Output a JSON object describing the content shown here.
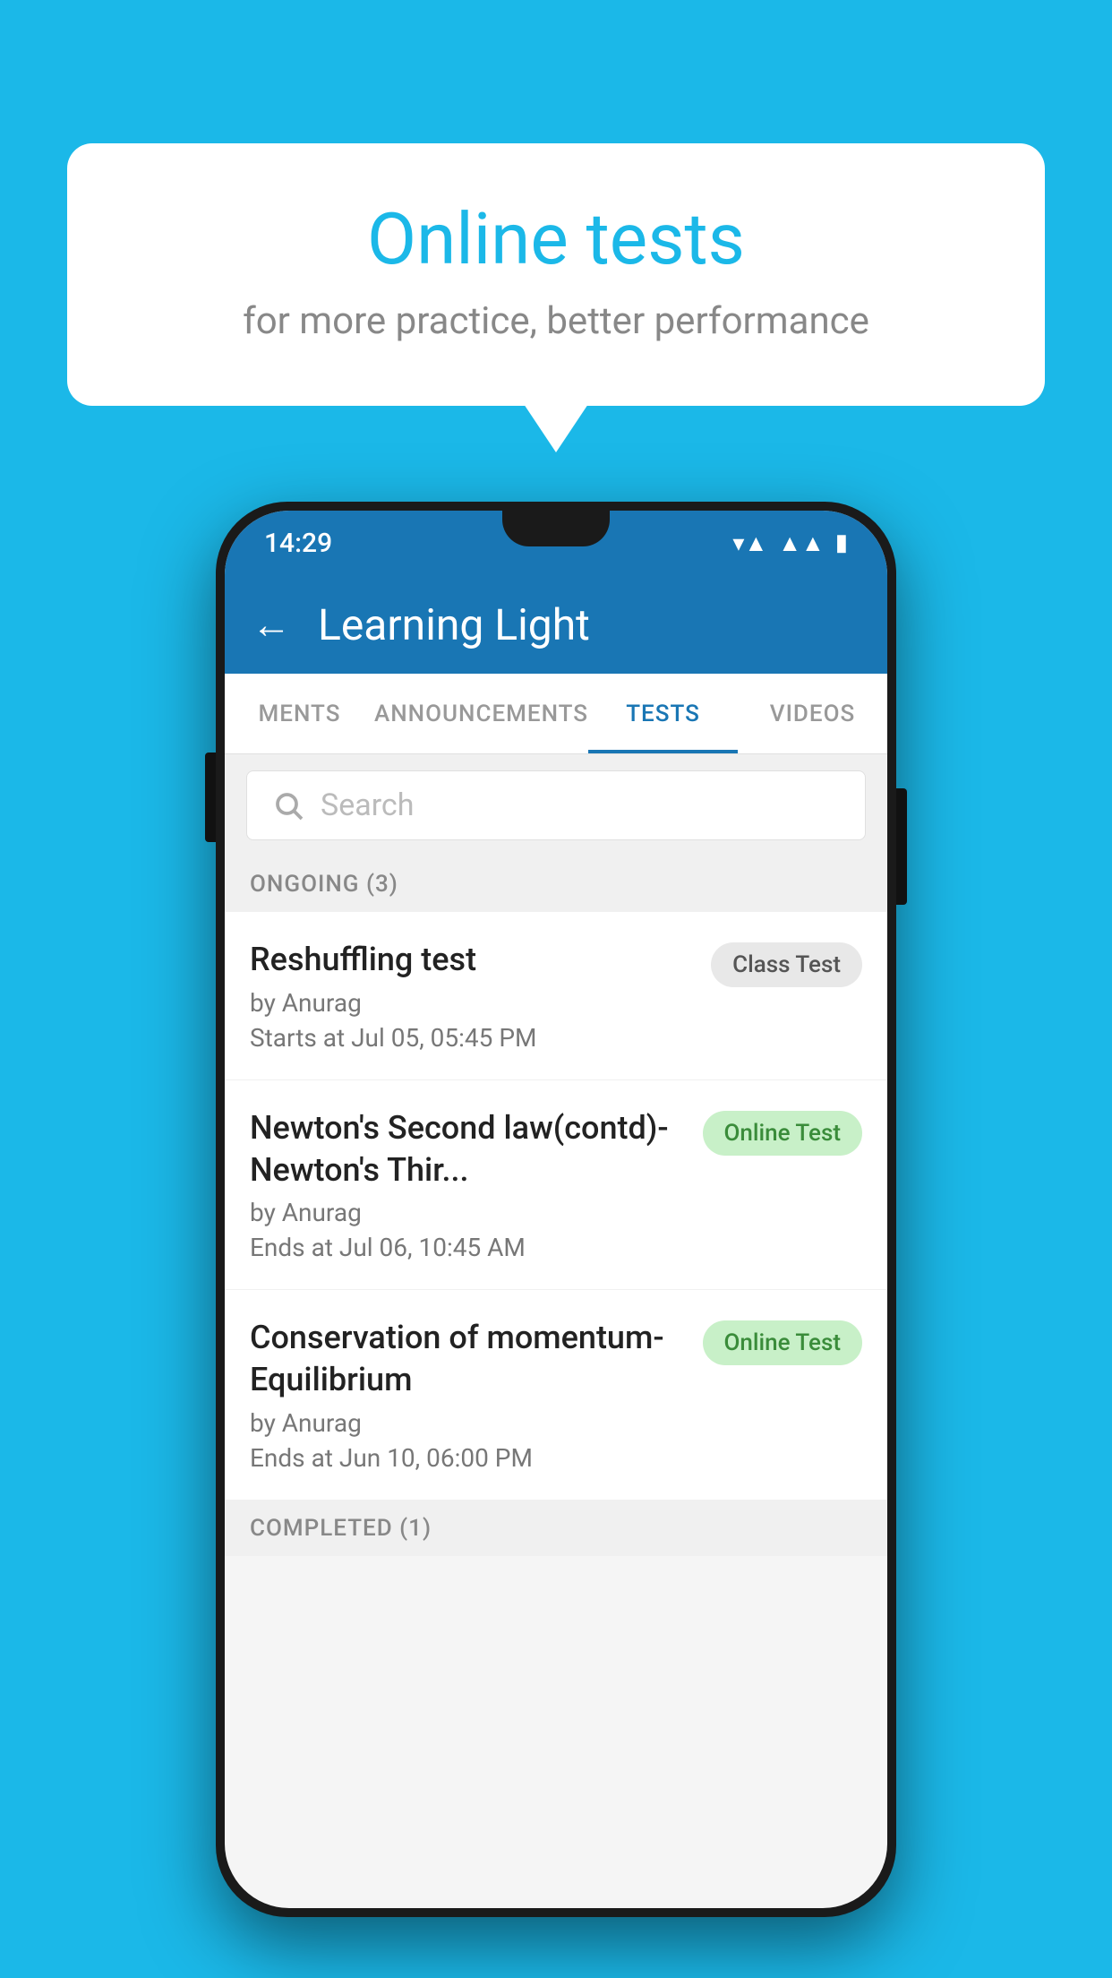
{
  "background": {
    "color": "#1bb8e8"
  },
  "speech_bubble": {
    "title": "Online tests",
    "subtitle": "for more practice, better performance"
  },
  "phone": {
    "status_bar": {
      "time": "14:29",
      "wifi": "▼▲",
      "signal": "▲▲",
      "battery": "▮"
    },
    "app_bar": {
      "back_label": "←",
      "title": "Learning Light"
    },
    "tabs": [
      {
        "label": "MENTS",
        "active": false
      },
      {
        "label": "ANNOUNCEMENTS",
        "active": false
      },
      {
        "label": "TESTS",
        "active": true
      },
      {
        "label": "VIDEOS",
        "active": false
      }
    ],
    "search": {
      "placeholder": "Search"
    },
    "ongoing_section": {
      "header": "ONGOING (3)",
      "items": [
        {
          "title": "Reshuffling test",
          "author": "by Anurag",
          "date": "Starts at  Jul 05, 05:45 PM",
          "badge": "Class Test",
          "badge_type": "class"
        },
        {
          "title": "Newton's Second law(contd)-Newton's Thir...",
          "author": "by Anurag",
          "date": "Ends at  Jul 06, 10:45 AM",
          "badge": "Online Test",
          "badge_type": "online"
        },
        {
          "title": "Conservation of momentum-Equilibrium",
          "author": "by Anurag",
          "date": "Ends at  Jun 10, 06:00 PM",
          "badge": "Online Test",
          "badge_type": "online"
        }
      ]
    },
    "completed_section": {
      "header": "COMPLETED (1)"
    }
  }
}
